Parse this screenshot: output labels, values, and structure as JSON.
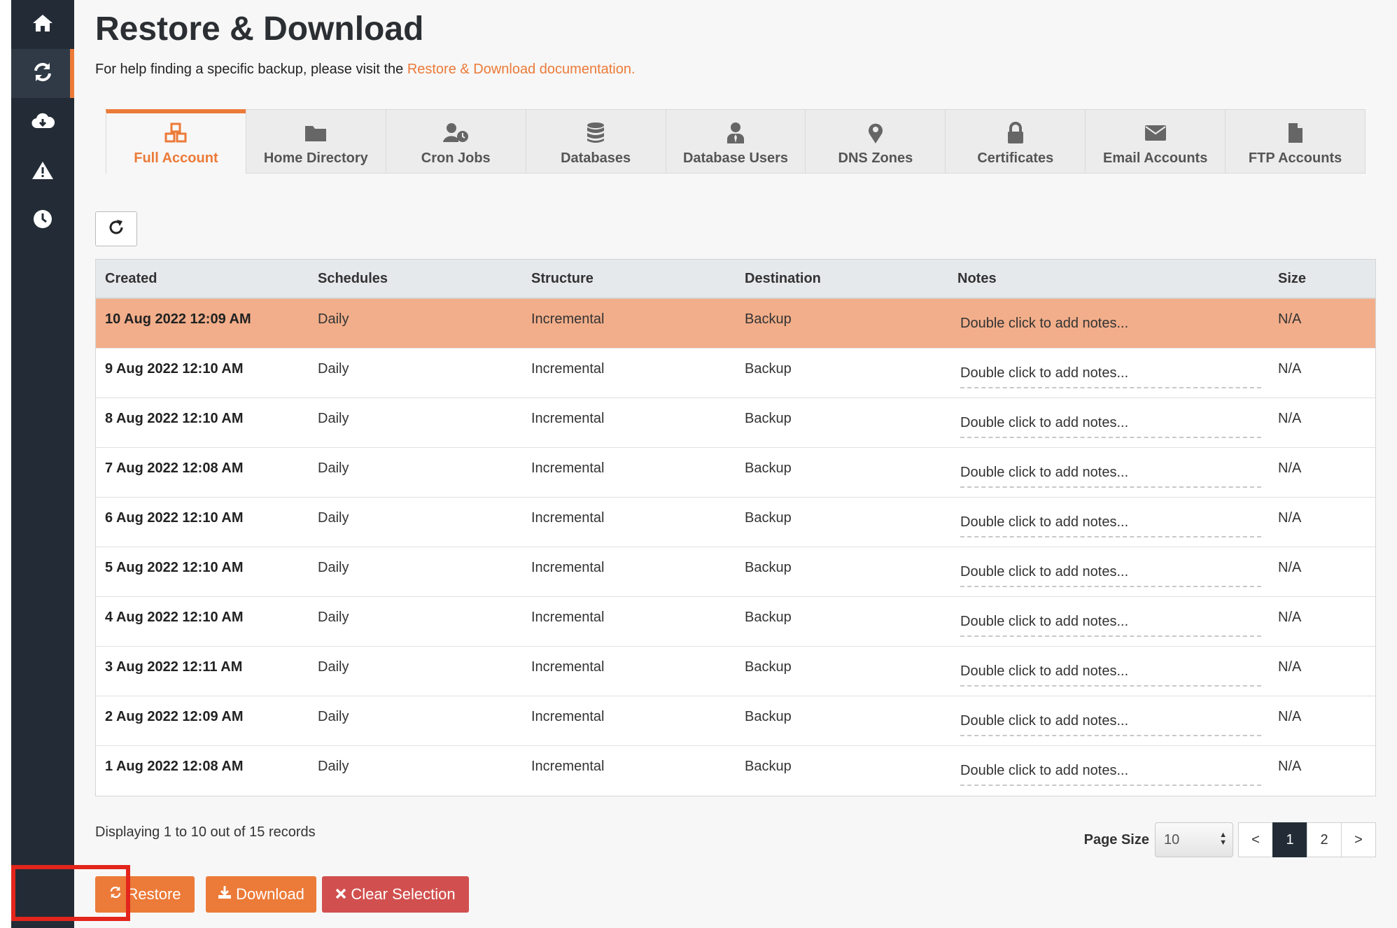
{
  "sidebar": {
    "items": [
      {
        "icon": "home-icon",
        "active": false
      },
      {
        "icon": "sync-icon",
        "active": true
      },
      {
        "icon": "cloud-download-icon",
        "active": false
      },
      {
        "icon": "warning-icon",
        "active": false
      },
      {
        "icon": "clock-icon",
        "active": false
      }
    ]
  },
  "page": {
    "title": "Restore & Download",
    "help_prefix": "For help finding a specific backup, please visit the ",
    "help_link": "Restore & Download documentation."
  },
  "tabs": [
    {
      "label": "Full Account",
      "icon": "cubes-icon",
      "active": true
    },
    {
      "label": "Home Directory",
      "icon": "folder-icon",
      "active": false
    },
    {
      "label": "Cron Jobs",
      "icon": "user-clock-icon",
      "active": false
    },
    {
      "label": "Databases",
      "icon": "database-icon",
      "active": false
    },
    {
      "label": "Database Users",
      "icon": "user-tie-icon",
      "active": false
    },
    {
      "label": "DNS Zones",
      "icon": "map-marker-icon",
      "active": false
    },
    {
      "label": "Certificates",
      "icon": "lock-icon",
      "active": false
    },
    {
      "label": "Email Accounts",
      "icon": "envelope-icon",
      "active": false
    },
    {
      "label": "FTP Accounts",
      "icon": "file-icon",
      "active": false
    }
  ],
  "table": {
    "columns": [
      "Created",
      "Schedules",
      "Structure",
      "Destination",
      "Notes",
      "Size"
    ],
    "rows": [
      {
        "created": "10 Aug 2022 12:09 AM",
        "schedules": "Daily",
        "structure": "Incremental",
        "destination": "Backup",
        "notes": "Double click to add notes...",
        "size": "N/A",
        "selected": true
      },
      {
        "created": "9 Aug 2022 12:10 AM",
        "schedules": "Daily",
        "structure": "Incremental",
        "destination": "Backup",
        "notes": "Double click to add notes...",
        "size": "N/A",
        "selected": false
      },
      {
        "created": "8 Aug 2022 12:10 AM",
        "schedules": "Daily",
        "structure": "Incremental",
        "destination": "Backup",
        "notes": "Double click to add notes...",
        "size": "N/A",
        "selected": false
      },
      {
        "created": "7 Aug 2022 12:08 AM",
        "schedules": "Daily",
        "structure": "Incremental",
        "destination": "Backup",
        "notes": "Double click to add notes...",
        "size": "N/A",
        "selected": false
      },
      {
        "created": "6 Aug 2022 12:10 AM",
        "schedules": "Daily",
        "structure": "Incremental",
        "destination": "Backup",
        "notes": "Double click to add notes...",
        "size": "N/A",
        "selected": false
      },
      {
        "created": "5 Aug 2022 12:10 AM",
        "schedules": "Daily",
        "structure": "Incremental",
        "destination": "Backup",
        "notes": "Double click to add notes...",
        "size": "N/A",
        "selected": false
      },
      {
        "created": "4 Aug 2022 12:10 AM",
        "schedules": "Daily",
        "structure": "Incremental",
        "destination": "Backup",
        "notes": "Double click to add notes...",
        "size": "N/A",
        "selected": false
      },
      {
        "created": "3 Aug 2022 12:11 AM",
        "schedules": "Daily",
        "structure": "Incremental",
        "destination": "Backup",
        "notes": "Double click to add notes...",
        "size": "N/A",
        "selected": false
      },
      {
        "created": "2 Aug 2022 12:09 AM",
        "schedules": "Daily",
        "structure": "Incremental",
        "destination": "Backup",
        "notes": "Double click to add notes...",
        "size": "N/A",
        "selected": false
      },
      {
        "created": "1 Aug 2022 12:08 AM",
        "schedules": "Daily",
        "structure": "Incremental",
        "destination": "Backup",
        "notes": "Double click to add notes...",
        "size": "N/A",
        "selected": false
      }
    ]
  },
  "footer": {
    "records_text": "Displaying 1 to 10 out of 15 records",
    "page_size_label": "Page Size",
    "page_size_value": "10",
    "pages": [
      "<",
      "1",
      "2",
      ">"
    ],
    "current_page": "1"
  },
  "actions": {
    "restore_label": "Restore",
    "download_label": "Download",
    "clear_label": "Clear Selection"
  },
  "colors": {
    "accent": "#ec7a38",
    "sidebar": "#232c36",
    "selected_row": "#f2ae8a",
    "danger": "#d1504f",
    "highlight_box": "#e3251c"
  }
}
